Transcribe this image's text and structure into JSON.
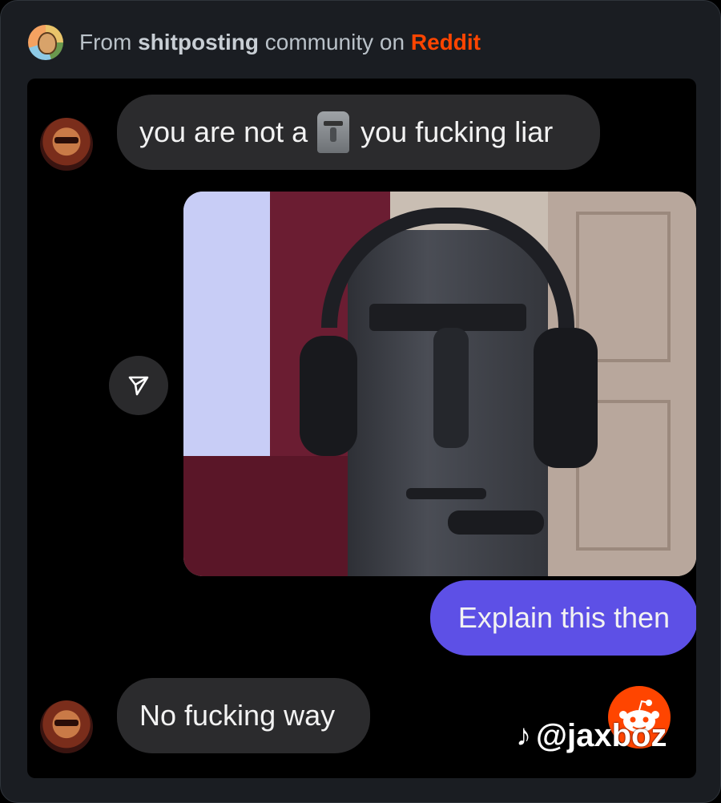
{
  "header": {
    "prefix": "From",
    "community": "shitposting",
    "middle": "community on",
    "platform": "Reddit",
    "icon": "community-avatar",
    "platform_color": "#ff4500"
  },
  "chat": {
    "message1_before": "you are not a",
    "message1_emoji": "moai-emoji",
    "message1_after": "you fucking liar",
    "reply": "Explain this then",
    "message3": "No fucking way",
    "reply_bubble_color": "#5d50e6"
  },
  "watermark": {
    "handle": "@jaxboz",
    "icon": "tiktok-icon"
  },
  "overlay_icon": "reddit-snoo-icon",
  "share_icon": "send-icon"
}
